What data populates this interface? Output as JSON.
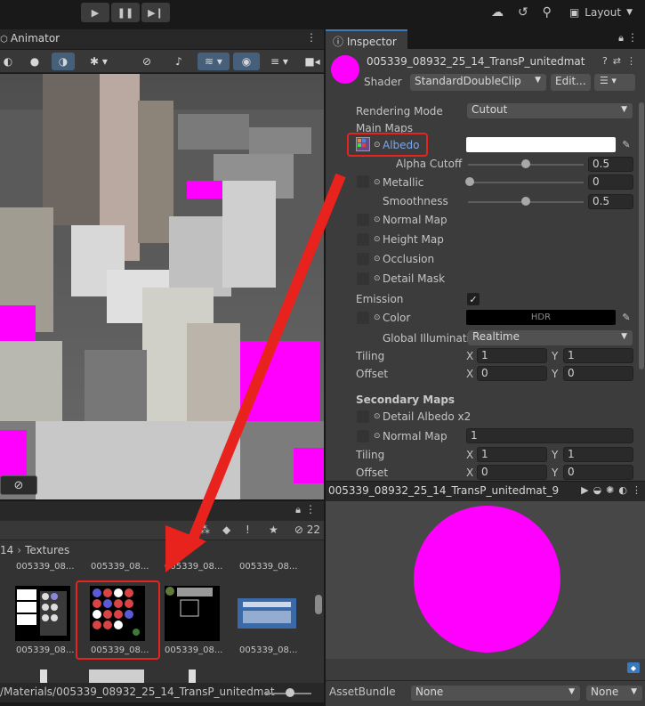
{
  "toolbar": {
    "play_icon": "play-icon",
    "pause_icon": "pause-icon",
    "step_icon": "step-icon",
    "layout_label": "Layout"
  },
  "scene": {
    "tab_label": "Animator"
  },
  "project": {
    "hidden_count": "22",
    "breadcrumb_prefix": "14",
    "breadcrumb_folder": "Textures",
    "top_asset_labels": [
      "005339_08...",
      "005339_08...",
      "005339_08...",
      "005339_08..."
    ],
    "bottom_asset_labels": [
      "005339_08...",
      "005339_08...",
      "005339_08...",
      "005339_08..."
    ],
    "path": "/Materials/005339_08932_25_14_TransP_unitedmat"
  },
  "inspector": {
    "tab_label": "Inspector",
    "material_name": "005339_08932_25_14_TransP_unitedmat",
    "shader_label": "Shader",
    "shader_value": "StandardDoubleClip",
    "edit_label": "Edit...",
    "rendering_mode_label": "Rendering Mode",
    "rendering_mode_value": "Cutout",
    "main_maps_label": "Main Maps",
    "albedo_label": "Albedo",
    "alpha_cutoff_label": "Alpha Cutoff",
    "alpha_cutoff_value": "0.5",
    "metallic_label": "Metallic",
    "metallic_value": "0",
    "smoothness_label": "Smoothness",
    "smoothness_value": "0.5",
    "normal_map_label": "Normal Map",
    "height_map_label": "Height Map",
    "occlusion_label": "Occlusion",
    "detail_mask_label": "Detail Mask",
    "emission_label": "Emission",
    "emission_color_label": "Color",
    "hdr_label": "HDR",
    "gi_label": "Global Illuminatic",
    "gi_value": "Realtime",
    "tiling_label": "Tiling",
    "offset_label": "Offset",
    "x_label": "X",
    "y_label": "Y",
    "main_tiling_x": "1",
    "main_tiling_y": "1",
    "main_offset_x": "0",
    "main_offset_y": "0",
    "secondary_maps_label": "Secondary Maps",
    "detail_albedo_label": "Detail Albedo x2",
    "sec_normal_map_label": "Normal Map",
    "sec_normal_value": "1",
    "sec_tiling_x": "1",
    "sec_tiling_y": "1",
    "sec_offset_x": "0",
    "sec_offset_y": "0",
    "colors": {
      "albedo": "#ffffff",
      "emission": "#000000",
      "material": "#ff00ff"
    }
  },
  "preview": {
    "title": "005339_08932_25_14_TransP_unitedmat_9"
  },
  "assetbundle": {
    "label": "AssetBundle",
    "name_value": "None",
    "variant_value": "None"
  },
  "annotation": {
    "color": "#e8221c"
  }
}
